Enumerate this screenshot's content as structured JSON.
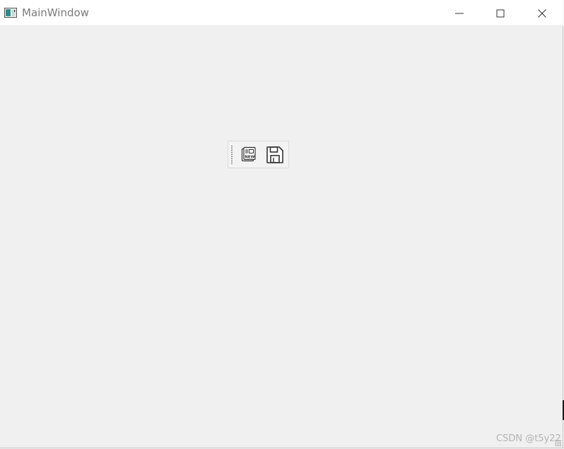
{
  "window": {
    "title": "MainWindow",
    "icon": "app-window-icon"
  },
  "caption_buttons": {
    "minimize": "minimize-icon",
    "maximize": "maximize-icon",
    "close": "close-icon"
  },
  "toolbar": {
    "buttons": [
      {
        "name": "new",
        "icon": "new-document-icon"
      },
      {
        "name": "save",
        "icon": "save-icon"
      }
    ]
  },
  "watermark": "CSDN @t5y22"
}
